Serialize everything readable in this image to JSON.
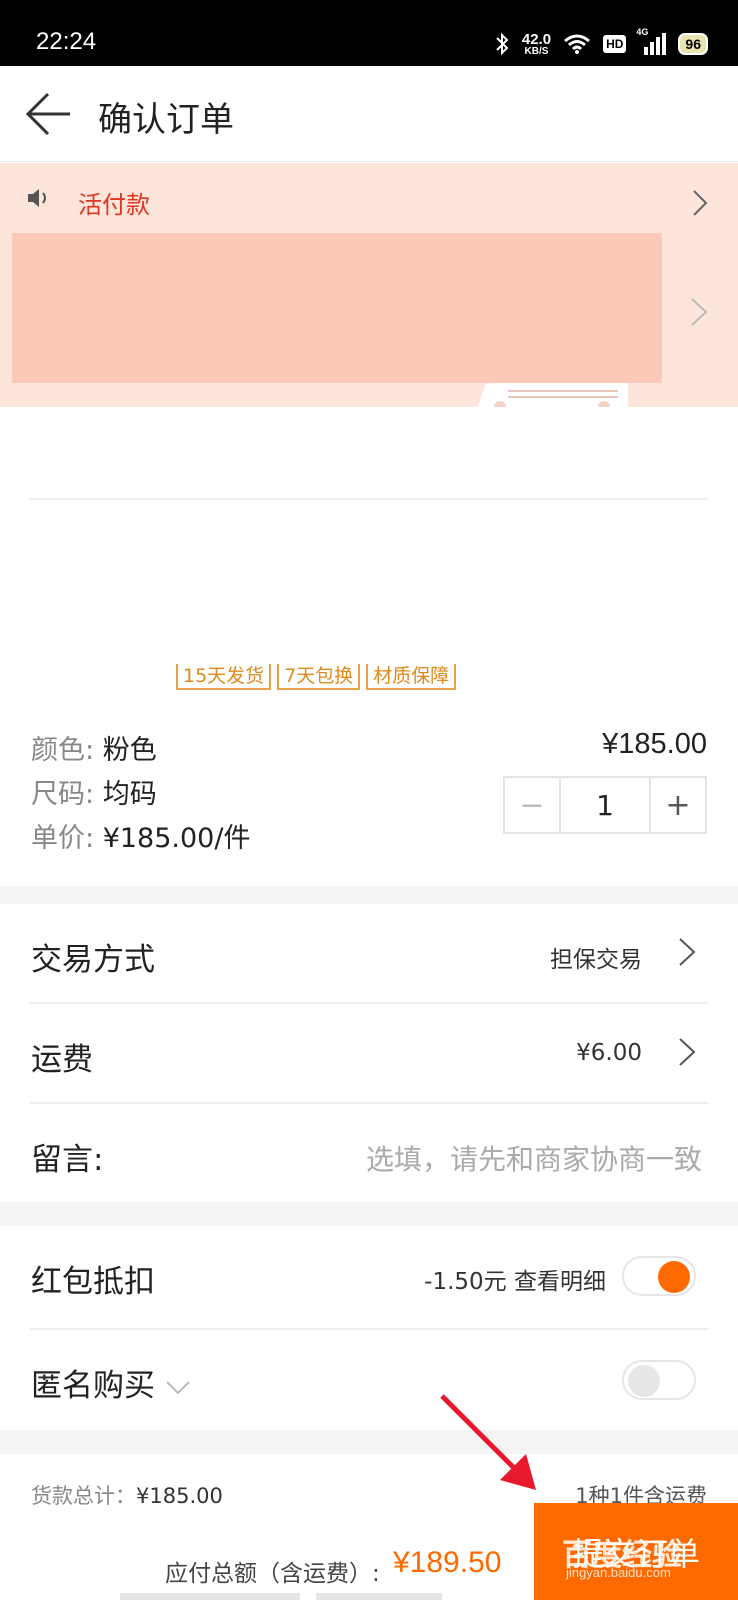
{
  "status_bar": {
    "time": "22:24",
    "net_speed": "42.0",
    "net_unit": "KB/S",
    "hd": "HD",
    "network": "4G",
    "battery": "96"
  },
  "header": {
    "title": "确认订单",
    "back_icon": "arrow-left-icon"
  },
  "banner": {
    "promo_text": "活付款",
    "speaker_icon": "speaker-icon",
    "bg_color": "#fde5dc"
  },
  "product": {
    "tags": [
      "15天发货",
      "7天包换",
      "材质保障"
    ],
    "color_key": "颜色:",
    "color_value": "粉色",
    "size_key": "尺码:",
    "size_value": "均码",
    "unit_price_key": "单价:",
    "unit_price_value": "¥185.00/件",
    "price": "¥185.00",
    "quantity": "1",
    "minus": "−",
    "plus": "+"
  },
  "rows": {
    "trade_label": "交易方式",
    "trade_value": "担保交易",
    "shipping_label": "运费",
    "shipping_value": "¥6.00",
    "note_label": "留言:",
    "note_placeholder": "选填，请先和商家协商一致",
    "redpacket_label": "红包抵扣",
    "redpacket_value": "-1.50元 查看明细",
    "redpacket_on": true,
    "anon_label": "匿名购买",
    "anon_on": false
  },
  "footer": {
    "goods_total_label": "货款总计：",
    "goods_total_value": "¥185.00",
    "items_summary": "1种1件含运费",
    "pay_label": "应付总额（含运费）:",
    "pay_amount": "¥189.50",
    "submit_label": "提交订单",
    "accent_color": "#ff6a00"
  },
  "watermark": {
    "text": "百度经验",
    "url": "jingyan.baidu.com"
  }
}
